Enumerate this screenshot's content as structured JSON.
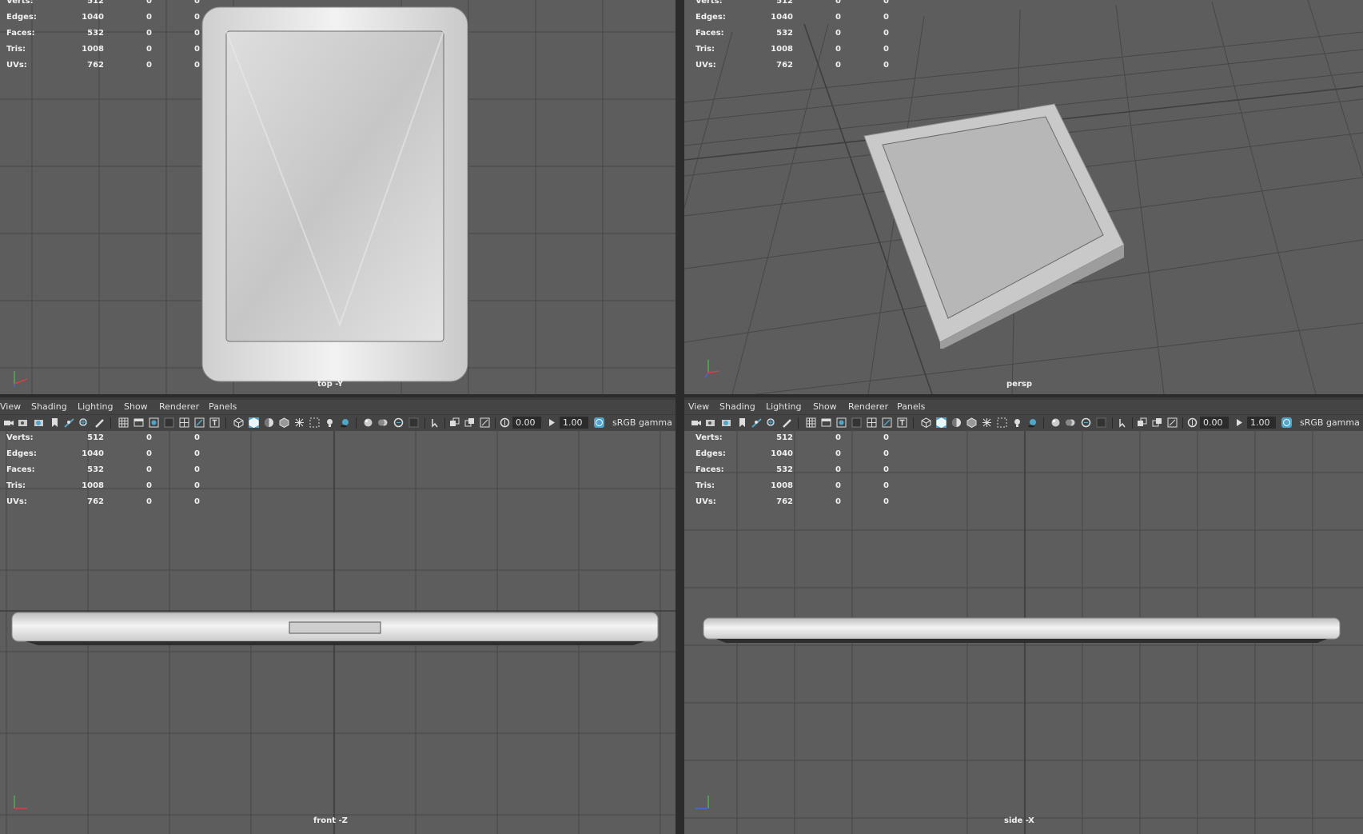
{
  "stats": {
    "rows": [
      {
        "label": "Verts:",
        "c1": "512",
        "c2": "0",
        "c3": "0"
      },
      {
        "label": "Edges:",
        "c1": "1040",
        "c2": "0",
        "c3": "0"
      },
      {
        "label": "Faces:",
        "c1": "532",
        "c2": "0",
        "c3": "0"
      },
      {
        "label": "Tris:",
        "c1": "1008",
        "c2": "0",
        "c3": "0"
      },
      {
        "label": "UVs:",
        "c1": "762",
        "c2": "0",
        "c3": "0"
      }
    ]
  },
  "viewports": {
    "top": {
      "camera": "top -Y"
    },
    "persp": {
      "camera": "persp"
    },
    "front": {
      "camera": "front -Z"
    },
    "side": {
      "camera": "side -X"
    }
  },
  "menu": {
    "view": "View",
    "shading": "Shading",
    "lighting": "Lighting",
    "show": "Show",
    "renderer": "Renderer",
    "panels": "Panels"
  },
  "toolbar": {
    "exposure": "0.00",
    "gamma_value": "1.00",
    "color_space": "sRGB gamma"
  },
  "colors": {
    "viewport_bg": "#5d5d5d",
    "accent": "#4fa6c9"
  }
}
